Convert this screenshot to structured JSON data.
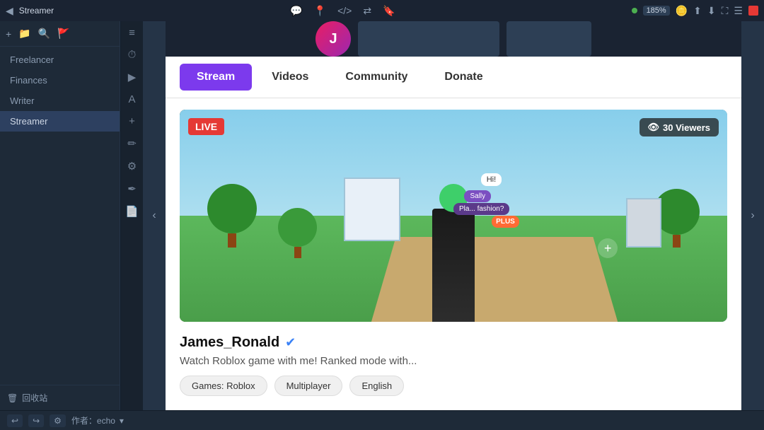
{
  "topbar": {
    "back_icon": "◀",
    "title": "Streamer",
    "center_icons": [
      "💬",
      "📍",
      "</>",
      "⇄",
      "🔖"
    ],
    "zoom": "185%",
    "record_color": "#e53935"
  },
  "sidebar": {
    "toolbar_icons": [
      "+",
      "📁",
      "🔍",
      "🚩"
    ],
    "items": [
      {
        "label": "Freelancer",
        "active": false
      },
      {
        "label": "Finances",
        "active": false
      },
      {
        "label": "Writer",
        "active": false
      },
      {
        "label": "Streamer",
        "active": true
      }
    ],
    "bottom_label": "回收站",
    "bottom_icon": "🗑"
  },
  "icon_sidebar": {
    "icons": [
      "≡",
      "⏱",
      "▶",
      "A",
      "+",
      "✏",
      "⚙",
      "✒",
      "📄"
    ]
  },
  "channel": {
    "channel_name_placeholder": ""
  },
  "tabs": {
    "items": [
      {
        "label": "Stream",
        "active": true
      },
      {
        "label": "Videos",
        "active": false
      },
      {
        "label": "Community",
        "active": false
      },
      {
        "label": "Donate",
        "active": false
      }
    ]
  },
  "stream": {
    "live_label": "LIVE",
    "viewers_icon": "👁",
    "viewers_count": "30 Viewers",
    "plus_label": "+",
    "streamer_name": "James_Ronald",
    "verified_icon": "✓",
    "description": "Watch Roblox game with me!  Ranked mode with...",
    "tags": [
      {
        "label": "Games: Roblox"
      },
      {
        "label": "Multiplayer"
      },
      {
        "label": "English"
      }
    ]
  },
  "nav": {
    "left_arrow": "‹",
    "right_arrow": "›"
  },
  "statusbar": {
    "undo_icon": "↩",
    "redo_icon": "↪",
    "settings_icon": "⚙",
    "author_label": "作者：echo",
    "bottom_label": "回收站"
  }
}
